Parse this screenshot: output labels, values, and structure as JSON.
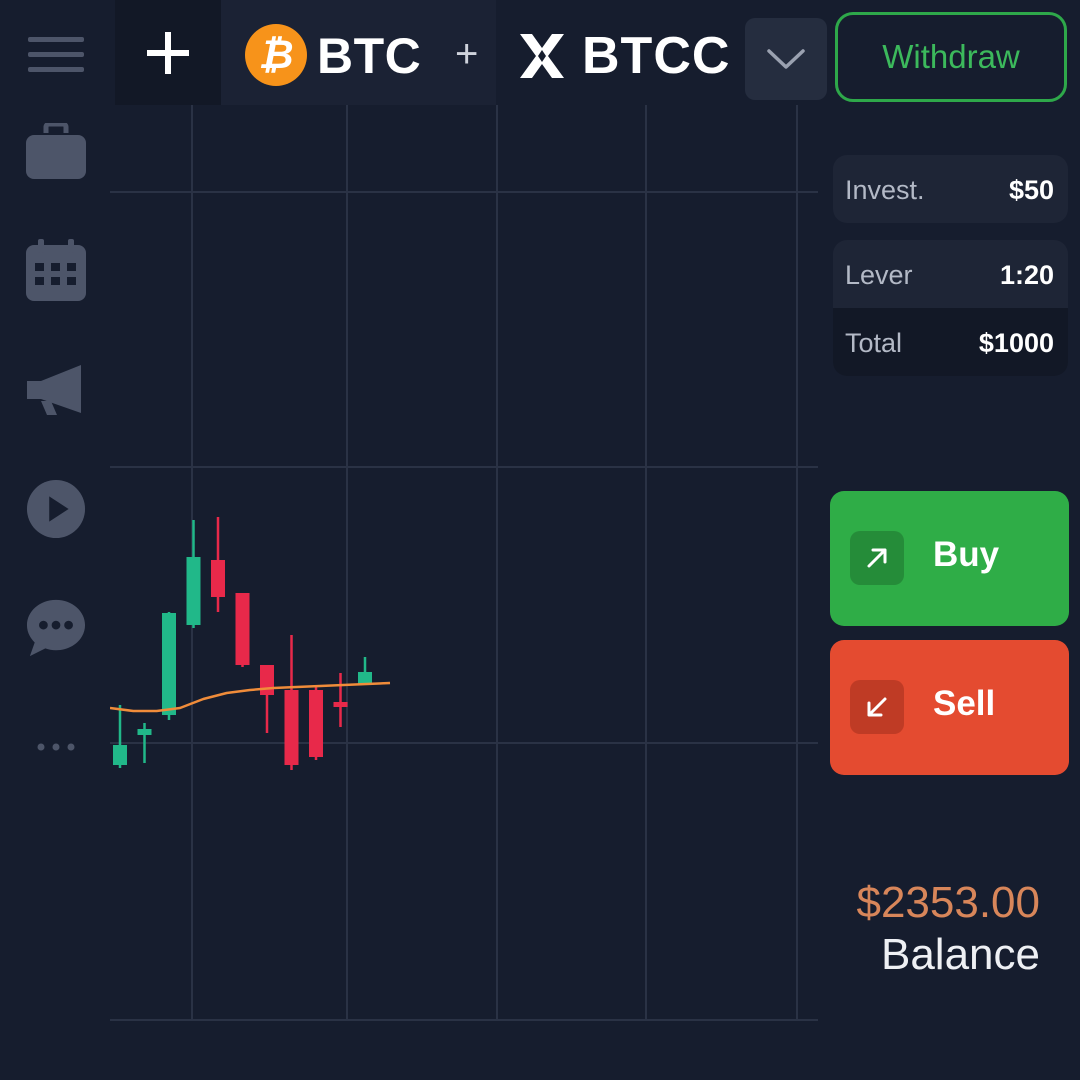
{
  "sidebar": {
    "items": [
      {
        "name": "menu-icon"
      },
      {
        "name": "briefcase-icon"
      },
      {
        "name": "calendar-icon"
      },
      {
        "name": "megaphone-icon"
      },
      {
        "name": "play-icon"
      },
      {
        "name": "chat-icon"
      },
      {
        "name": "more-icon"
      }
    ]
  },
  "header": {
    "add_icon": "plus-icon",
    "asset_label": "BTC",
    "plus_sign": "+",
    "brand_label": "BTCC",
    "dropdown_icon": "chevron-down-icon",
    "withdraw_label": "Withdraw"
  },
  "trade_settings": {
    "invest": {
      "label": "Invest.",
      "value": "$50"
    },
    "lever": {
      "label": "Lever",
      "value": "1:20"
    },
    "total": {
      "label": "Total",
      "value": "$1000"
    }
  },
  "actions": {
    "buy_label": "Buy",
    "sell_label": "Sell"
  },
  "balance": {
    "amount": "$2353.00",
    "label": "Balance"
  },
  "colors": {
    "background": "#161d2e",
    "up": "#21b889",
    "down": "#e8294a",
    "ma_line": "#f08c3a",
    "buy": "#2fad47",
    "sell": "#e44b30",
    "balance_amount": "#d8865a"
  },
  "chart_data": {
    "type": "candlestick",
    "title": "",
    "xlabel": "",
    "ylabel": "",
    "grid": true,
    "candles": [
      {
        "open": 40,
        "close": 60,
        "high": 100,
        "low": 37
      },
      {
        "open": 70,
        "close": 76,
        "high": 82,
        "low": 42
      },
      {
        "open": 90,
        "close": 192,
        "high": 193,
        "low": 85
      },
      {
        "open": 180,
        "close": 248,
        "high": 285,
        "low": 177
      },
      {
        "open": 245,
        "close": 208,
        "high": 288,
        "low": 193
      },
      {
        "open": 212,
        "close": 140,
        "high": 212,
        "low": 138
      },
      {
        "open": 140,
        "close": 110,
        "high": 120,
        "low": 72
      },
      {
        "open": 115,
        "close": 40,
        "high": 170,
        "low": 35
      },
      {
        "open": 115,
        "close": 48,
        "high": 118,
        "low": 45
      },
      {
        "open": 103,
        "close": 98,
        "high": 132,
        "low": 78
      },
      {
        "open": 120,
        "close": 133,
        "high": 148,
        "low": 120
      }
    ],
    "moving_average": [
      97,
      94,
      94,
      97,
      106,
      112,
      115,
      117,
      118,
      119,
      120,
      121,
      122
    ]
  }
}
